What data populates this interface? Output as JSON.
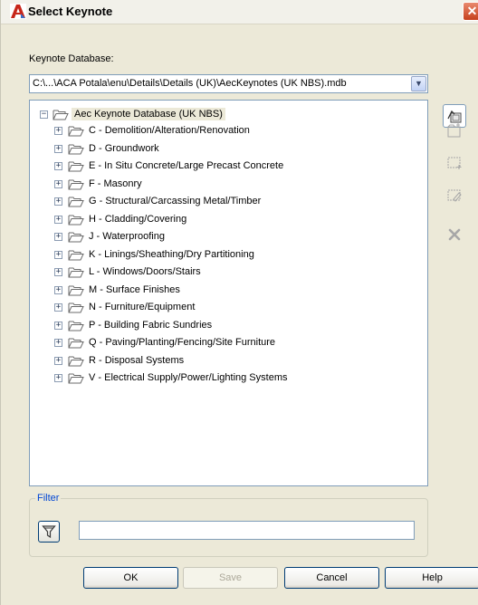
{
  "window": {
    "title": "Select Keynote",
    "close_label": "✕"
  },
  "keynote_database": {
    "label": "Keynote Database:",
    "selected_path": "C:\\...\\ACA Potala\\enu\\Details\\Details (UK)\\AecKeynotes (UK NBS).mdb"
  },
  "tree": {
    "root": "Aec Keynote Database (UK NBS)",
    "items": [
      "C - Demolition/Alteration/Renovation",
      "D - Groundwork",
      "E - In Situ Concrete/Large Precast Concrete",
      "F - Masonry",
      "G - Structural/Carcassing Metal/Timber",
      "H - Cladding/Covering",
      "J - Waterproofing",
      "K - Linings/Sheathing/Dry Partitioning",
      "L - Windows/Doors/Stairs",
      "M - Surface Finishes",
      "N - Furniture/Equipment",
      "P - Building Fabric Sundries",
      "Q - Paving/Planting/Fencing/Site Furniture",
      "R - Disposal Systems",
      "V - Electrical Supply/Power/Lighting Systems"
    ]
  },
  "filter": {
    "legend": "Filter",
    "value": ""
  },
  "buttons": {
    "ok": "OK",
    "save": "Save",
    "cancel": "Cancel",
    "help": "Help"
  },
  "toolbar": [
    "open-database-icon",
    "add-group-icon",
    "add-keynote-icon",
    "edit-keynote-icon",
    "delete-icon"
  ],
  "colors": {
    "dialog_bg": "#ece9d8",
    "border": "#7f9db9",
    "close_red": "#c6401d"
  }
}
